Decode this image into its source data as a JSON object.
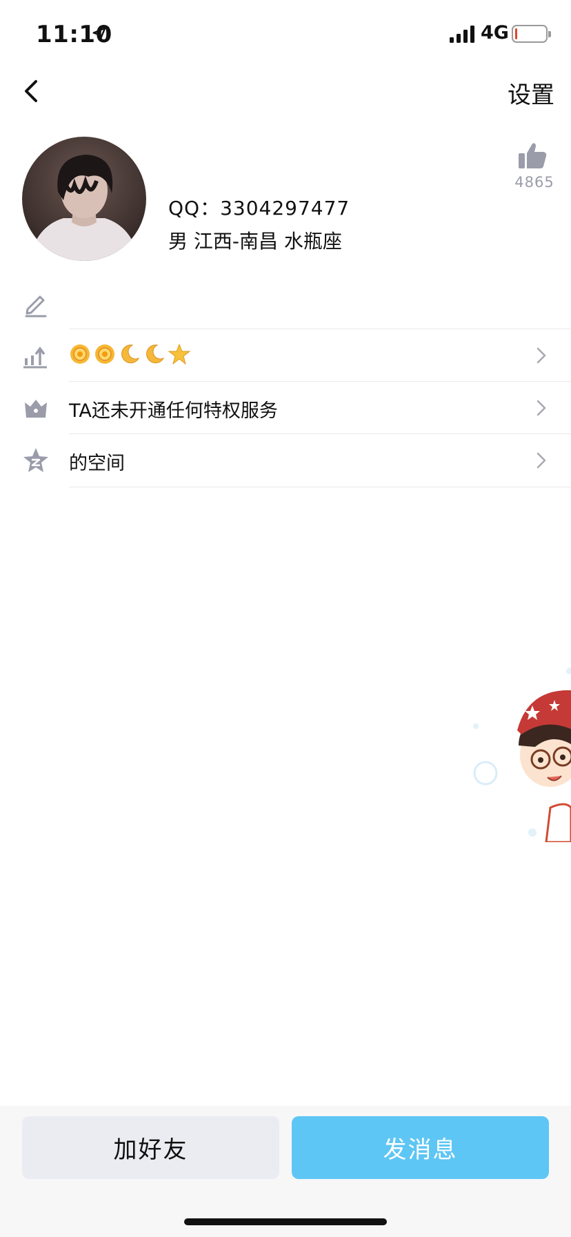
{
  "status_bar": {
    "time": "11:10",
    "network": "4G",
    "battery_level": 0.05,
    "battery_color": "#e0442e"
  },
  "nav": {
    "settings_label": "设置"
  },
  "profile": {
    "qq_line": "QQ：3304297477",
    "info_line": "男  江西-南昌  水瓶座",
    "like_count": "4865"
  },
  "rows": [
    {
      "icon": "edit-pencil-icon",
      "label": ""
    },
    {
      "icon": "level-chart-icon",
      "badges": [
        "sun-badge",
        "sun-badge",
        "moon-badge",
        "moon-badge",
        "star-badge"
      ]
    },
    {
      "icon": "crown-icon",
      "label": "TA还未开通任何特权服务"
    },
    {
      "icon": "qzone-star-icon",
      "label": "的空间"
    }
  ],
  "actions": {
    "add_friend_label": "加好友",
    "send_message_label": "发消息"
  },
  "colors": {
    "accent": "#5ec6f4",
    "icon_gray": "#9a9caa",
    "secondary_button": "#ebebf2"
  }
}
